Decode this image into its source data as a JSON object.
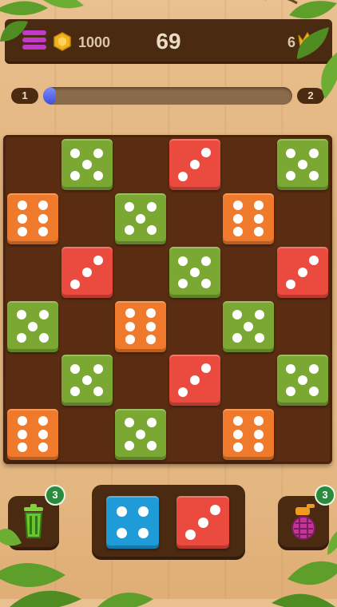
{
  "header": {
    "coins": "1000",
    "level": "69",
    "crowns": "6"
  },
  "progress": {
    "current_level": "1",
    "next_level": "2",
    "fraction": 0.05
  },
  "colors": {
    "green": "#7aa832",
    "orange": "#f07a2b",
    "red": "#ea4b3e",
    "blue": "#1f9bd8"
  },
  "board": {
    "rows": 6,
    "cols": 6,
    "cells": [
      {
        "row": 0,
        "col": 1,
        "color": "green",
        "pips": 5
      },
      {
        "row": 0,
        "col": 3,
        "color": "red",
        "pips": 3
      },
      {
        "row": 0,
        "col": 5,
        "color": "green",
        "pips": 5
      },
      {
        "row": 1,
        "col": 0,
        "color": "orange",
        "pips": 6
      },
      {
        "row": 1,
        "col": 2,
        "color": "green",
        "pips": 5
      },
      {
        "row": 1,
        "col": 4,
        "color": "orange",
        "pips": 6
      },
      {
        "row": 2,
        "col": 1,
        "color": "red",
        "pips": 3
      },
      {
        "row": 2,
        "col": 3,
        "color": "green",
        "pips": 5
      },
      {
        "row": 2,
        "col": 5,
        "color": "red",
        "pips": 3
      },
      {
        "row": 3,
        "col": 0,
        "color": "green",
        "pips": 5
      },
      {
        "row": 3,
        "col": 2,
        "color": "orange",
        "pips": 6
      },
      {
        "row": 3,
        "col": 4,
        "color": "green",
        "pips": 5
      },
      {
        "row": 4,
        "col": 1,
        "color": "green",
        "pips": 5
      },
      {
        "row": 4,
        "col": 3,
        "color": "red",
        "pips": 3
      },
      {
        "row": 4,
        "col": 5,
        "color": "green",
        "pips": 5
      },
      {
        "row": 5,
        "col": 0,
        "color": "orange",
        "pips": 6
      },
      {
        "row": 5,
        "col": 2,
        "color": "green",
        "pips": 5
      },
      {
        "row": 5,
        "col": 4,
        "color": "orange",
        "pips": 6
      }
    ]
  },
  "next_pieces": [
    {
      "color": "blue",
      "pips": 4
    },
    {
      "color": "red",
      "pips": 3
    }
  ],
  "powerups": {
    "trash_count": "3",
    "spray_count": "3",
    "trash_icon": "trash-icon",
    "spray_icon": "grenade-spray-icon"
  }
}
